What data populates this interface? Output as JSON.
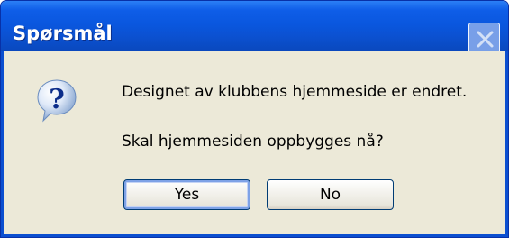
{
  "window": {
    "title": "Spørsmål",
    "close_icon": "close-icon"
  },
  "message": {
    "icon": "question-icon",
    "line1": "Designet av klubbens hjemmeside er endret.",
    "line2": "Skal hjemmesiden oppbygges nå?"
  },
  "buttons": {
    "yes_label": "Yes",
    "no_label": "No"
  },
  "colors": {
    "titlebar": "#0a57df",
    "dialog_background": "#ece9d8",
    "button_border": "#003c74",
    "default_focus_ring": "#7ea2e6"
  }
}
